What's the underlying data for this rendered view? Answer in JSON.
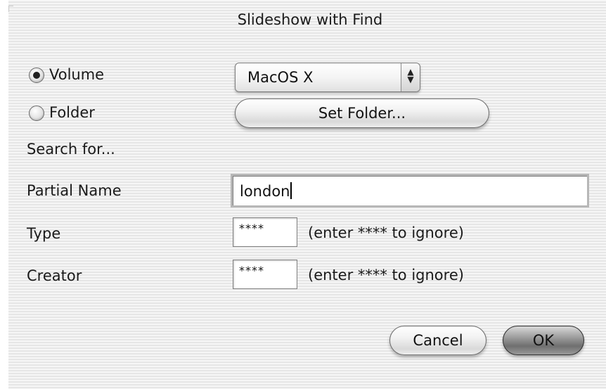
{
  "window": {
    "title": "Slideshow with Find"
  },
  "source": {
    "volume_label": "Volume",
    "volume_selected": true,
    "folder_label": "Folder",
    "folder_selected": false,
    "volume_popup_value": "MacOS X",
    "popup_arrows_up": "▲",
    "popup_arrows_down": "▼",
    "set_folder_label": "Set Folder..."
  },
  "search": {
    "heading": "Search for...",
    "partial_name_label": "Partial Name",
    "partial_name_value": "london",
    "type_label": "Type",
    "type_value": "****",
    "type_hint": "(enter **** to ignore)",
    "creator_label": "Creator",
    "creator_value": "****",
    "creator_hint": "(enter **** to ignore)"
  },
  "buttons": {
    "cancel_label": "Cancel",
    "ok_label": "OK"
  }
}
